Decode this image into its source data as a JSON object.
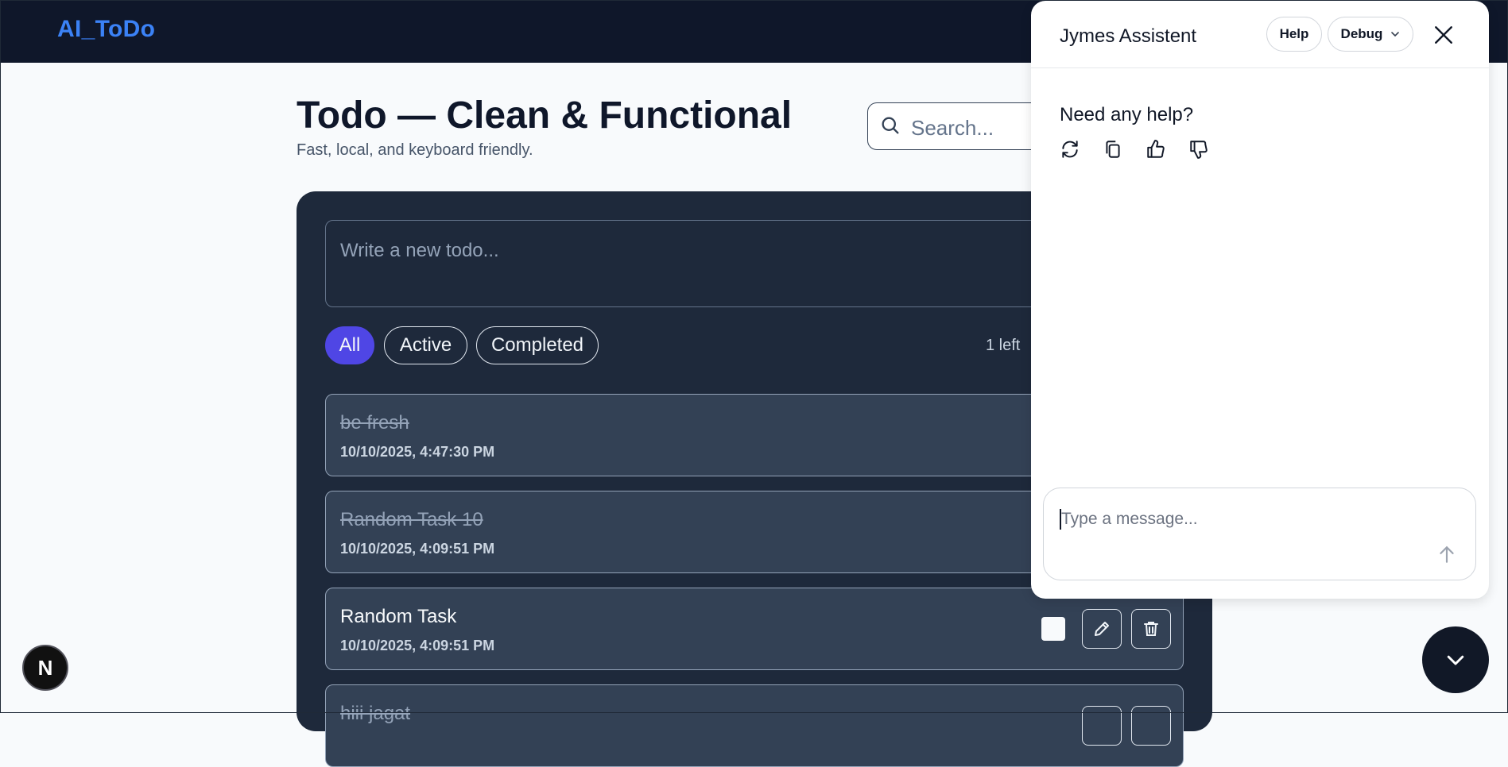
{
  "app": {
    "brand": "AI_ToDo"
  },
  "header": {
    "title": "Todo — Clean & Functional",
    "subtitle": "Fast, local, and keyboard friendly.",
    "search_placeholder": "Search..."
  },
  "composer": {
    "placeholder": "Write a new todo..."
  },
  "filters": [
    {
      "label": "All",
      "selected": true
    },
    {
      "label": "Active",
      "selected": false
    },
    {
      "label": "Completed",
      "selected": false
    }
  ],
  "items_left": "1 left",
  "todos": [
    {
      "title": "be fresh",
      "date": "10/10/2025, 4:47:30 PM",
      "completed": true
    },
    {
      "title": "Random Task 10",
      "date": "10/10/2025, 4:09:51 PM",
      "completed": true
    },
    {
      "title": "Random Task",
      "date": "10/10/2025, 4:09:51 PM",
      "completed": false
    },
    {
      "title": "hiii jagat",
      "date": "",
      "completed": true
    }
  ],
  "assistant": {
    "title": "Jymes Assistent",
    "help_label": "Help",
    "debug_label": "Debug",
    "greeting": "Need any help?",
    "message_placeholder": "Type a message...",
    "actions": [
      "refresh-icon",
      "copy-icon",
      "thumbs-up-icon",
      "thumbs-down-icon"
    ]
  },
  "badge": {
    "letter": "N"
  },
  "colors": {
    "navy": "#0f172a",
    "brand_blue": "#3b82f6",
    "accent_indigo": "#4f46e5",
    "panel": "#1e293b",
    "card": "#334155"
  }
}
